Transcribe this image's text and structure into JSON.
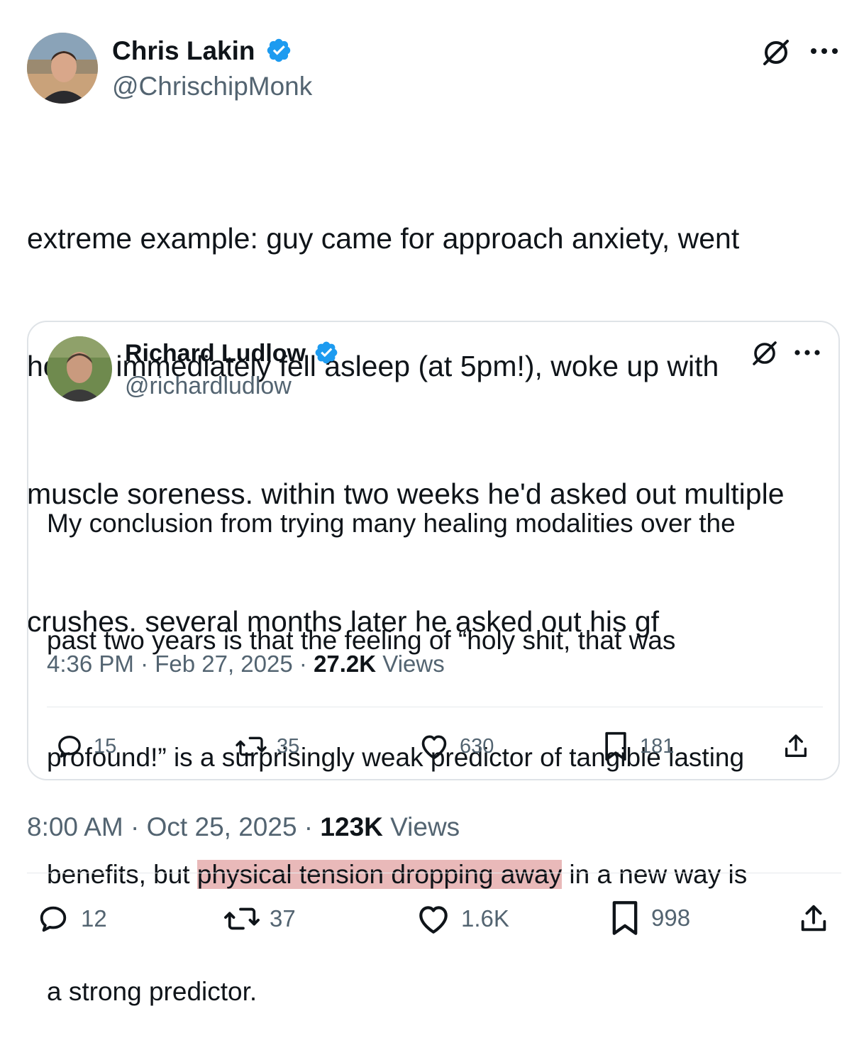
{
  "main_tweet": {
    "author_name": "Chris Lakin",
    "author_handle": "@ChrischipMonk",
    "text_lines": [
      "extreme example: guy came for approach anxiety, went",
      "home, immediately fell asleep (at 5pm!), woke up with",
      "muscle soreness. within two weeks he'd asked out multiple",
      "crushes. several months later he asked out his gf"
    ],
    "time": "8:00 AM",
    "date": "Oct 25, 2025",
    "views_count": "123K",
    "views_label": "Views",
    "replies": "12",
    "reposts": "37",
    "likes": "1.6K",
    "bookmarks": "998"
  },
  "quoted_tweet": {
    "author_name": "Richard Ludlow",
    "author_handle": "@richardludlow",
    "text": {
      "line1": "My conclusion from trying many healing modalities over the",
      "line2": "past two years is that the feeling of “holy shit, that was",
      "line3": "profound!” is a surprisingly weak predictor of tangible lasting",
      "line4_before": "benefits, but ",
      "line4_highlight": "physical tension dropping away",
      "line4_after": " in a new way is",
      "line5": "a strong predictor."
    },
    "time": "4:36 PM",
    "date": "Feb 27, 2025",
    "views_count": "27.2K",
    "views_label": "Views",
    "replies": "15",
    "reposts": "35",
    "likes": "630",
    "bookmarks": "181"
  },
  "colors": {
    "text": "#0f1419",
    "secondary": "#536471",
    "verified": "#1d9bf0",
    "highlight": "#e9b9b9",
    "border": "#dfe3e7"
  },
  "icons": [
    "verified-badge-icon",
    "grok-icon",
    "more-icon",
    "reply-icon",
    "repost-icon",
    "like-icon",
    "bookmark-icon",
    "share-icon"
  ]
}
